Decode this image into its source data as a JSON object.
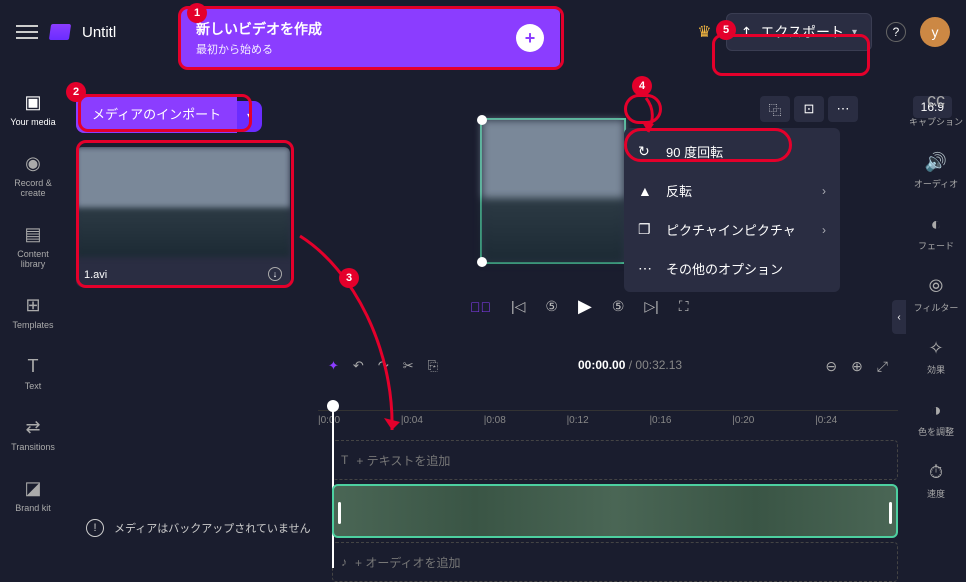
{
  "popup": {
    "title": "新しいビデオを作成",
    "subtitle": "最初から始める"
  },
  "app_title": "Untitl",
  "export_label": "エクスポート",
  "avatar_letter": "y",
  "ratio": "16:9",
  "left_rail": [
    {
      "icon": "▣",
      "label": "Your media"
    },
    {
      "icon": "◉",
      "label": "Record & create"
    },
    {
      "icon": "▤",
      "label": "Content library"
    },
    {
      "icon": "⊞",
      "label": "Templates"
    },
    {
      "icon": "T",
      "label": "Text"
    },
    {
      "icon": "⇄",
      "label": "Transitions"
    },
    {
      "icon": "◪",
      "label": "Brand kit"
    }
  ],
  "right_rail": [
    {
      "icon": "cc",
      "label": "キャプション"
    },
    {
      "icon": "🔊",
      "label": "オーディオ"
    },
    {
      "icon": "◐",
      "label": "フェード"
    },
    {
      "icon": "⦾",
      "label": "フィルター"
    },
    {
      "icon": "✧",
      "label": "効果"
    },
    {
      "icon": "◑",
      "label": "色を調整"
    },
    {
      "icon": "⏱",
      "label": "速度"
    }
  ],
  "import_label": "メディアのインポート",
  "media_file": "1.avi",
  "backup_msg": "メディアはバックアップされていません",
  "context_menu": [
    {
      "icon": "↻",
      "label": "90 度回転",
      "chev": false
    },
    {
      "icon": "▲",
      "label": "反転",
      "chev": true
    },
    {
      "icon": "❐",
      "label": "ピクチャインピクチャ",
      "chev": true
    },
    {
      "icon": "⋯",
      "label": "その他のオプション",
      "chev": false
    }
  ],
  "time_current": "00:00.00",
  "time_total": "00:32.13",
  "ruler_ticks": [
    "|0:00",
    "|0:04",
    "|0:08",
    "|0:12",
    "|0:16",
    "|0:20",
    "|0:24"
  ],
  "track_text": "+ テキストを追加",
  "track_audio": "+ オーディオを追加"
}
